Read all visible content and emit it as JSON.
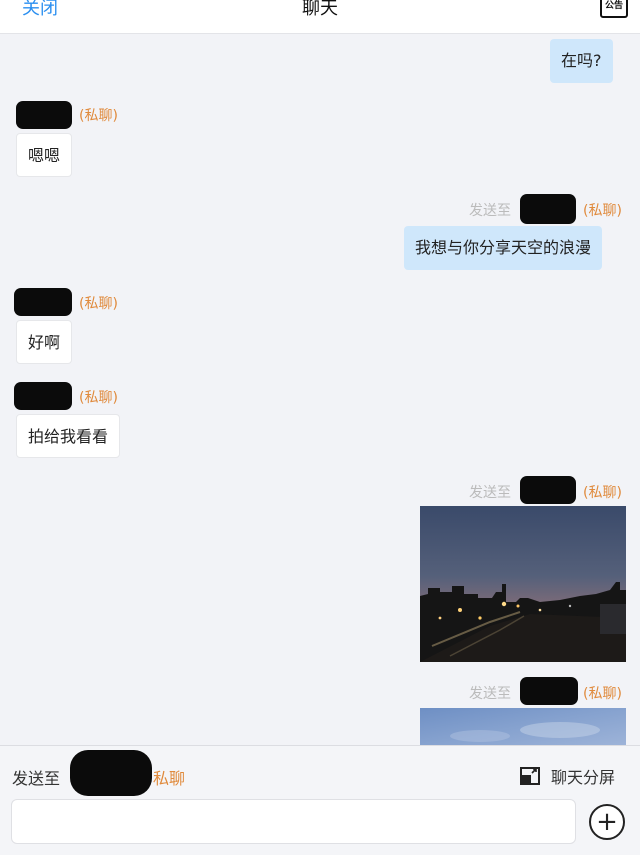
{
  "header": {
    "close_label": "关闭",
    "title": "聊天",
    "notice_label": "公告"
  },
  "messages": [
    {
      "direction": "outgoing",
      "text": "在吗?"
    },
    {
      "direction": "incoming",
      "tag": "(私聊)",
      "text": "嗯嗯"
    },
    {
      "direction": "outgoing",
      "prefix": "发送至",
      "tag": "(私聊)",
      "text": "我想与你分享天空的浪漫"
    },
    {
      "direction": "incoming",
      "tag": "(私聊)",
      "text": "好啊"
    },
    {
      "direction": "incoming",
      "tag": "(私聊)",
      "text": "拍给我看看"
    },
    {
      "direction": "outgoing",
      "prefix": "发送至",
      "tag": "(私聊)",
      "image": "dusk-city-skyline-photo"
    },
    {
      "direction": "outgoing",
      "prefix": "发送至",
      "tag": "(私聊)",
      "image": "blue-sky-photo"
    }
  ],
  "footer": {
    "send_to_label": "发送至",
    "private_label": "私聊",
    "split_label": "聊天分屏",
    "input_value": "",
    "input_placeholder": ""
  },
  "colors": {
    "accent_blue": "#2b8ff0",
    "private_orange": "#e08a3c",
    "outgoing_bubble": "#cfe7fb",
    "incoming_bubble": "#ffffff",
    "background": "#f2f3f7"
  },
  "icons": {
    "notice": "notice-board-icon",
    "split": "split-screen-icon",
    "add": "plus-circle-icon"
  }
}
